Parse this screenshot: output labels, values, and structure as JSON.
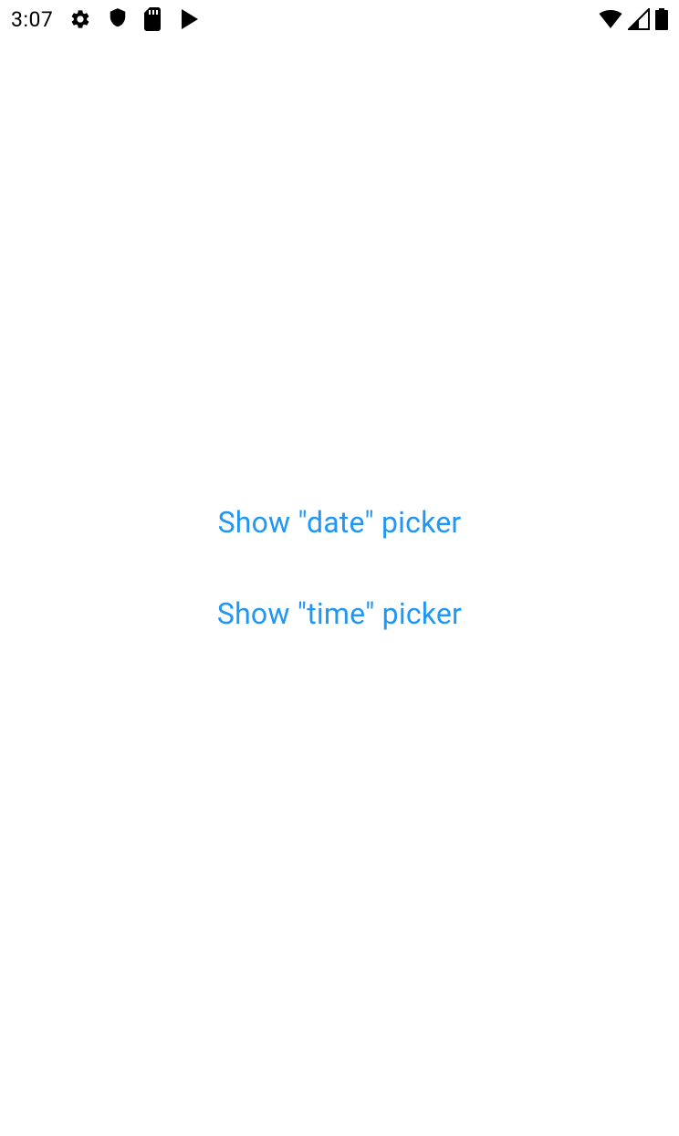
{
  "status_bar": {
    "time": "3:07",
    "icons": {
      "gear": "gear-icon",
      "shield": "shield-icon",
      "sd_card": "sd-card-icon",
      "play": "play-store-icon",
      "wifi": "wifi-icon",
      "signal": "cellular-signal-icon",
      "battery": "battery-icon"
    }
  },
  "main": {
    "date_picker_label": "Show \"date\" picker",
    "time_picker_label": "Show \"time\" picker"
  },
  "colors": {
    "link": "#2196F3",
    "background": "#ffffff",
    "status_text": "#000000"
  }
}
